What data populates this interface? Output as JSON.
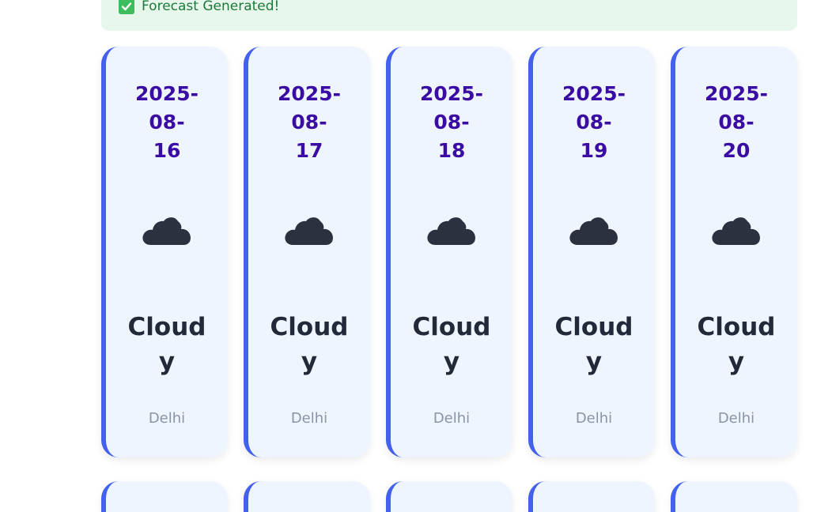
{
  "alert": {
    "message": "Forecast Generated!"
  },
  "cards": [
    {
      "date_lines": [
        "2025-",
        "08-",
        "16"
      ],
      "icon": "cloud-icon",
      "condition_lines": [
        "Cloud",
        "y"
      ],
      "city": "Delhi"
    },
    {
      "date_lines": [
        "2025-",
        "08-",
        "17"
      ],
      "icon": "cloud-icon",
      "condition_lines": [
        "Cloud",
        "y"
      ],
      "city": "Delhi"
    },
    {
      "date_lines": [
        "2025-",
        "08-",
        "18"
      ],
      "icon": "cloud-icon",
      "condition_lines": [
        "Cloud",
        "y"
      ],
      "city": "Delhi"
    },
    {
      "date_lines": [
        "2025-",
        "08-",
        "19"
      ],
      "icon": "cloud-icon",
      "condition_lines": [
        "Cloud",
        "y"
      ],
      "city": "Delhi"
    },
    {
      "date_lines": [
        "2025-",
        "08-",
        "20"
      ],
      "icon": "cloud-icon",
      "condition_lines": [
        "Cloud",
        "y"
      ],
      "city": "Delhi"
    }
  ],
  "colors": {
    "accent": "#4361ee",
    "date": "#3a0ca3",
    "card_bg": "#eff5ff",
    "success_bg": "#e8f7ec",
    "success_text": "#1d7a3a"
  }
}
